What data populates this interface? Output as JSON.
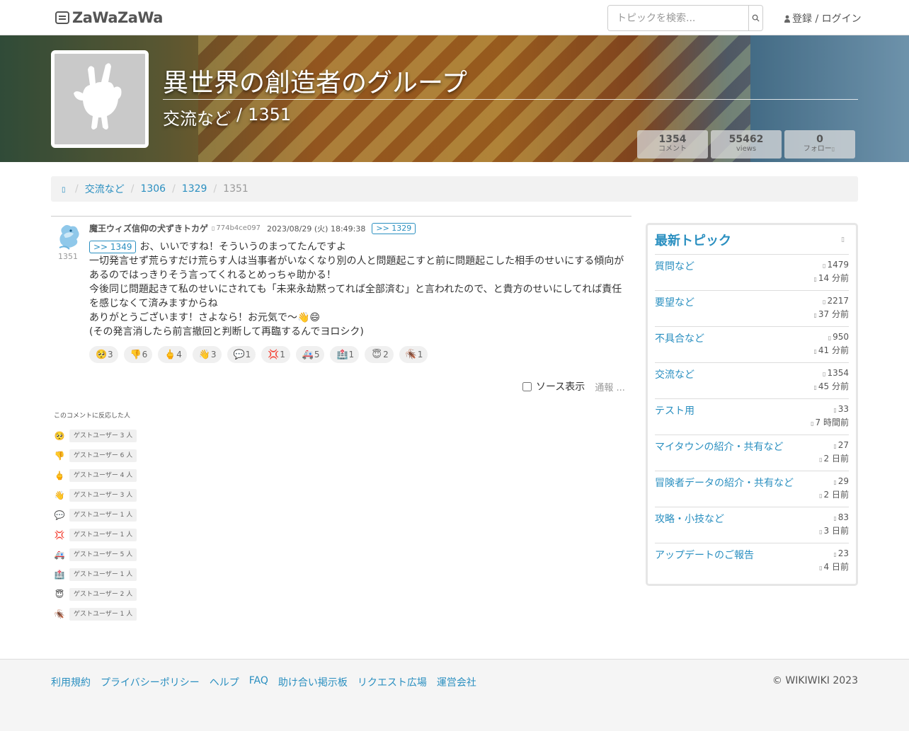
{
  "nav": {
    "logo": "ZaWaZaWa",
    "search_placeholder": "トピックを検索...",
    "search_icon": "search-icon",
    "login_label": "登録 / ログイン",
    "login_icon": "user-icon"
  },
  "banner": {
    "group_title": "異世界の創造者のグループ",
    "topic": "交流など",
    "separator": "/",
    "comment_no": "1351",
    "stats": [
      {
        "value": "1354",
        "label": "コメント"
      },
      {
        "value": "55462",
        "label": "views"
      },
      {
        "value": "0",
        "label": "フォロー"
      }
    ]
  },
  "breadcrumb": {
    "home_icon": "home-icon",
    "items": [
      "交流など",
      "1306",
      "1329",
      "1351"
    ]
  },
  "comment": {
    "number": "1351",
    "author": "魔王ウィズ信仰の犬ずきトカゲ",
    "user_id": "774b4ce097",
    "date": "2023/08/29 (火) 18:49:38",
    "reply_to": ">> 1329",
    "inline_reply": ">> 1349",
    "lines": [
      "お、いいですね！そういうのまってたんですよ",
      "一切発言せず荒らすだけ荒らす人は当事者がいなくなり別の人と問題起こすと前に問題起こした相手のせいにする傾向があるのではっきりそう言ってくれるとめっちゃ助かる！",
      "今後同じ問題起きて私のせいにされても「未来永劫黙ってれば全部済む」と言われたので、と貴方のせいにしてれば責任を感じなくて済みますからね",
      "ありがとうございます！さよなら！お元気で〜👋😄",
      "(その発言消したら前言撤回と判断して再臨するんでヨロシク)"
    ],
    "source_label": "ソース表示",
    "report_label": "通報 ..."
  },
  "reactions": [
    {
      "emoji": "🥺",
      "count": "3"
    },
    {
      "emoji": "👎",
      "count": "6"
    },
    {
      "emoji": "🖕",
      "count": "4"
    },
    {
      "emoji": "👋",
      "count": "3"
    },
    {
      "emoji": "💬",
      "count": "1"
    },
    {
      "emoji": "💢",
      "count": "1"
    },
    {
      "emoji": "🚑",
      "count": "5"
    },
    {
      "emoji": "🏥",
      "count": "1"
    },
    {
      "emoji": "😇",
      "count": "2"
    },
    {
      "emoji": "🪳",
      "count": "1"
    }
  ],
  "reacted": {
    "title": "このコメントに反応した人",
    "items": [
      {
        "emoji": "🥺",
        "label": "ゲストユーザー 3 人"
      },
      {
        "emoji": "👎",
        "label": "ゲストユーザー 6 人"
      },
      {
        "emoji": "🖕",
        "label": "ゲストユーザー 4 人"
      },
      {
        "emoji": "👋",
        "label": "ゲストユーザー 3 人"
      },
      {
        "emoji": "💬",
        "label": "ゲストユーザー 1 人"
      },
      {
        "emoji": "💢",
        "label": "ゲストユーザー 1 人"
      },
      {
        "emoji": "🚑",
        "label": "ゲストユーザー 5 人"
      },
      {
        "emoji": "🏥",
        "label": "ゲストユーザー 1 人"
      },
      {
        "emoji": "😇",
        "label": "ゲストユーザー 2 人"
      },
      {
        "emoji": "🪳",
        "label": "ゲストユーザー 1 人"
      }
    ]
  },
  "sidebar": {
    "title": "最新トピック",
    "topics": [
      {
        "name": "質問など",
        "count": "1479",
        "time": "14 分前"
      },
      {
        "name": "要望など",
        "count": "2217",
        "time": "37 分前"
      },
      {
        "name": "不具合など",
        "count": "950",
        "time": "41 分前"
      },
      {
        "name": "交流など",
        "count": "1354",
        "time": "45 分前"
      },
      {
        "name": "テスト用",
        "count": "33",
        "time": "7 時間前"
      },
      {
        "name": "マイタウンの紹介・共有など",
        "count": "27",
        "time": "2 日前"
      },
      {
        "name": "冒険者データの紹介・共有など",
        "count": "29",
        "time": "2 日前"
      },
      {
        "name": "攻略・小技など",
        "count": "83",
        "time": "3 日前"
      },
      {
        "name": "アップデートのご報告",
        "count": "23",
        "time": "4 日前"
      }
    ]
  },
  "footer": {
    "links": [
      "利用規約",
      "プライバシーポリシー",
      "ヘルプ",
      "FAQ",
      "助け合い掲示板",
      "リクエスト広場",
      "運営会社"
    ],
    "copyright": "© WIKIWIKI 2023"
  },
  "colors": {
    "link": "#2a8fc0",
    "avatar_bg": "#c9c9c9"
  }
}
